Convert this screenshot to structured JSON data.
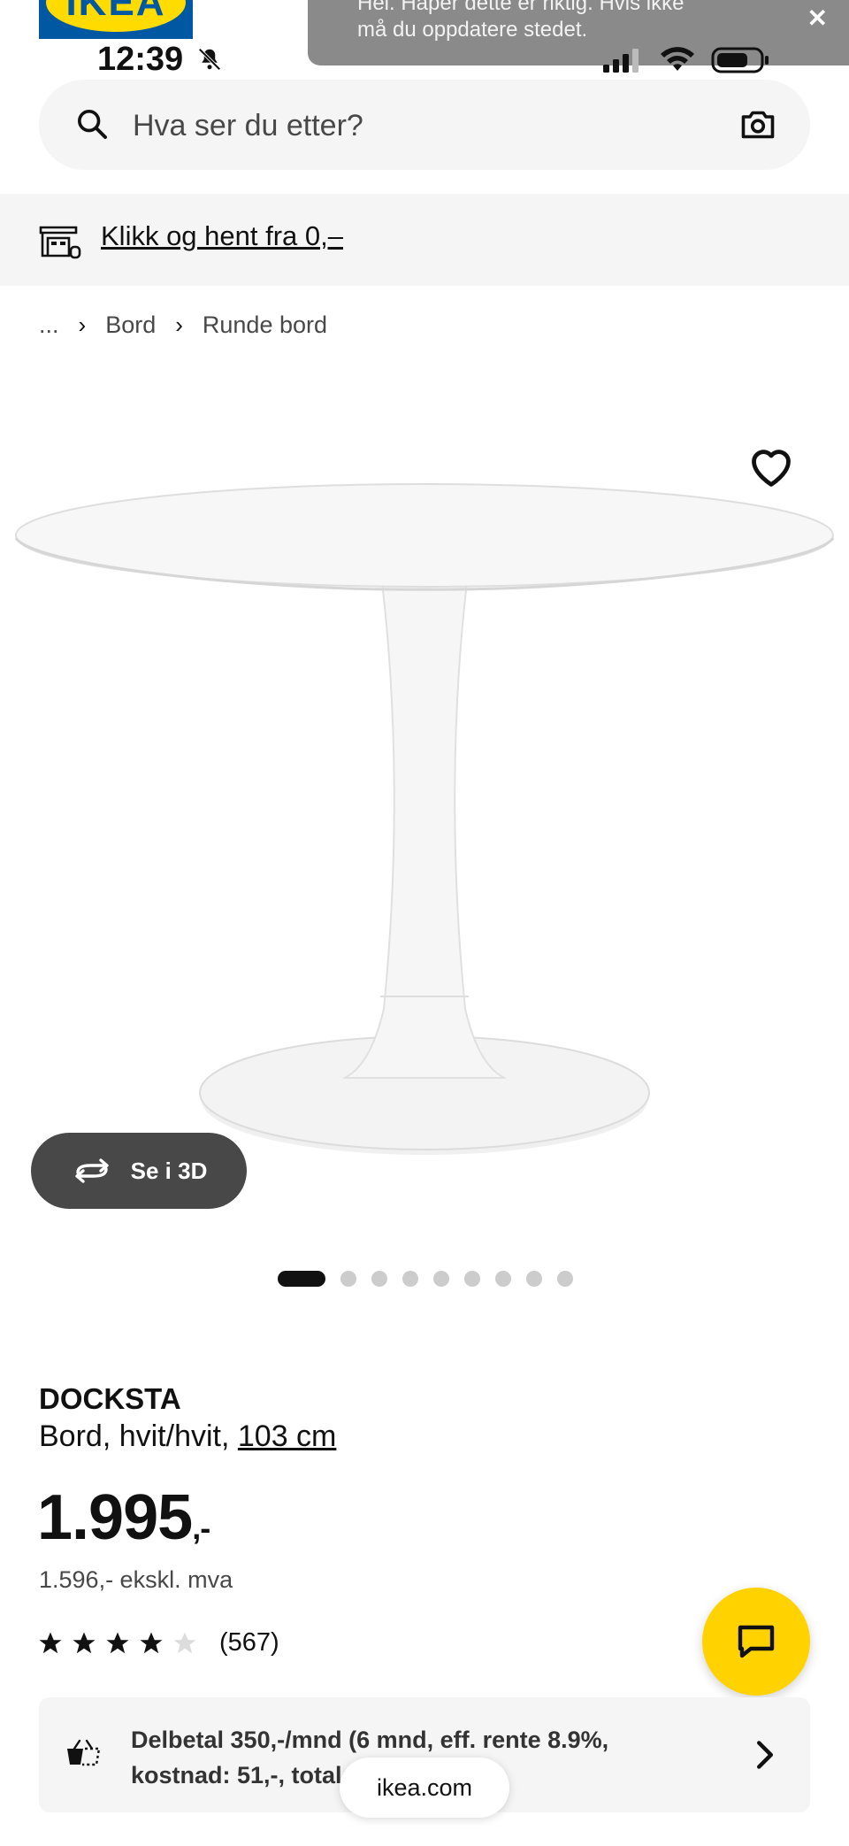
{
  "status_bar": {
    "time": "12:39",
    "icons": [
      "bell-slash-icon",
      "signal-icon",
      "wifi-icon",
      "battery-icon"
    ]
  },
  "notification": {
    "line1": "Hei. Håper dette er riktig. Hvis ikke",
    "line2": "må du oppdatere stedet.",
    "close": "✕"
  },
  "logo": {
    "text": "IKEA"
  },
  "search": {
    "placeholder": "Hva ser du etter?"
  },
  "click_collect": {
    "label": "Klikk og hent fra 0,–"
  },
  "breadcrumb": {
    "ellipsis": "...",
    "items": [
      "Bord",
      "Runde bord"
    ],
    "separator": "›"
  },
  "product": {
    "name": "DOCKSTA",
    "desc_prefix": "Bord, hvit/hvit,",
    "size": "103 cm",
    "price": "1.995",
    "price_suffix": ",-",
    "price_ex_vat": "1.596,- ekskl. mva",
    "rating": 4,
    "rating_max": 5,
    "review_count": "(567)",
    "view_3d_label": "Se i 3D",
    "image_count": 9,
    "active_image": 0
  },
  "installment": {
    "line1": "Delbetal 350,-/mnd (6 mnd, eff. rente 8.9%,",
    "line2": "kostnad: 51,-, total: 2.046,-)"
  },
  "browser": {
    "url": "ikea.com"
  },
  "colors": {
    "accent_yellow": "#ffd200",
    "ikea_blue": "#0058a3",
    "dark_button": "#484848"
  }
}
